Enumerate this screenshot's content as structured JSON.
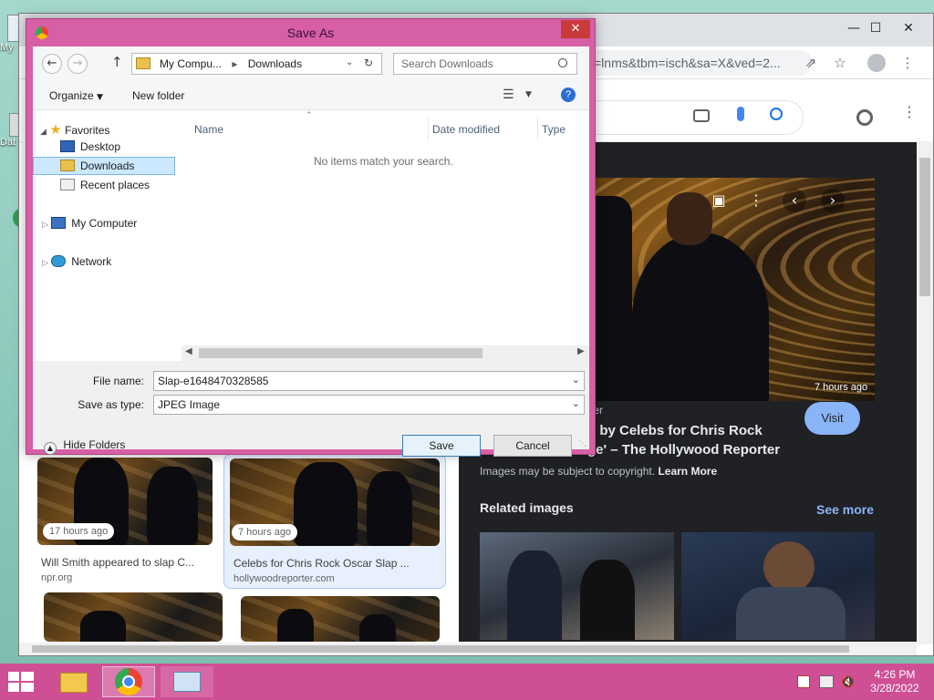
{
  "desktop": {
    "icons": [
      "My",
      "Dat"
    ]
  },
  "chrome": {
    "url_fragment": "=lnms&tbm=isch&sa=X&ved=2...",
    "controls": {
      "minimize": "—",
      "maximize": "☐",
      "close": "✕"
    }
  },
  "results": {
    "cards": [
      {
        "time": "17 hours ago",
        "title": "Will Smith appeared to slap C...",
        "source": "npr.org"
      },
      {
        "time": "7 hours ago",
        "title": "Celebs for Chris Rock Oscar Slap ...",
        "source": "hollywoodreporter.com"
      }
    ]
  },
  "preview": {
    "time": "7 hours ago",
    "source_label": "rter",
    "title_line1": "d by Celebs for Chris Rock",
    "title_line2": "ge' – The Hollywood Reporter",
    "visit_label": "Visit",
    "copyright_text": "Images may be subject to copyright.",
    "learn_more": "Learn More",
    "related_title": "Related images",
    "see_more": "See more"
  },
  "dialog": {
    "title": "Save As",
    "close_glyph": "✕",
    "breadcrumb": [
      "My Compu...",
      "Downloads"
    ],
    "search_placeholder": "Search Downloads",
    "organize_label": "Organize",
    "new_folder_label": "New folder",
    "tree": {
      "favorites": "Favorites",
      "desktop": "Desktop",
      "downloads": "Downloads",
      "recent": "Recent places",
      "computer": "My Computer",
      "network": "Network"
    },
    "columns": [
      "Name",
      "Date modified",
      "Type"
    ],
    "empty_message": "No items match your search.",
    "file_name_label": "File name:",
    "file_name_value": "Slap-e1648470328585",
    "save_type_label": "Save as type:",
    "save_type_value": "JPEG Image",
    "hide_folders_label": "Hide Folders",
    "save_label": "Save",
    "cancel_label": "Cancel"
  },
  "taskbar": {
    "time": "4:26 PM",
    "date": "3/28/2022"
  },
  "colors": {
    "dialog_frame": "#d65fa6",
    "taskbar": "#cf4f95",
    "preview_bg": "#202124",
    "visit_button": "#8ab4f8",
    "link_blue": "#8ab4f8"
  }
}
